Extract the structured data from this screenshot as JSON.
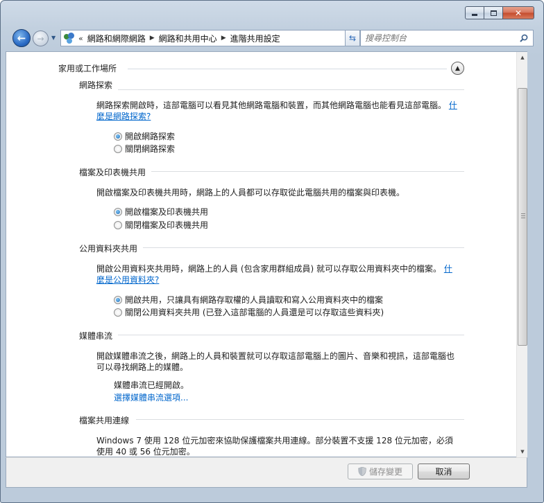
{
  "window": {
    "minimize_icon": "minimize-icon",
    "maximize_icon": "maximize-icon",
    "close_icon": "close-icon"
  },
  "nav": {
    "breadcrumb_overflow": "«",
    "breadcrumbs": [
      {
        "label": "網路和網際網路"
      },
      {
        "label": "網路和共用中心"
      },
      {
        "label": "進階共用設定"
      }
    ],
    "search_placeholder": "搜尋控制台"
  },
  "profile": {
    "title": "家用或工作場所"
  },
  "sections": [
    {
      "title": "網路探索",
      "description": "網路探索開啟時，這部電腦可以看見其他網路電腦和裝置，而其他網路電腦也能看見這部電腦。",
      "link": "什麼是網路探索?",
      "options": [
        {
          "label": "開啟網路探索",
          "checked": true
        },
        {
          "label": "關閉網路探索",
          "checked": false
        }
      ]
    },
    {
      "title": "檔案及印表機共用",
      "description": "開啟檔案及印表機共用時，網路上的人員都可以存取從此電腦共用的檔案與印表機。",
      "options": [
        {
          "label": "開啟檔案及印表機共用",
          "checked": true
        },
        {
          "label": "關閉檔案及印表機共用",
          "checked": false
        }
      ]
    },
    {
      "title": "公用資料夾共用",
      "description": "開啟公用資料夾共用時，網路上的人員 (包含家用群組成員) 就可以存取公用資料夾中的檔案。",
      "link": "什麼是公用資料夾?",
      "options": [
        {
          "label": "開啟共用，只讓具有網路存取權的人員讀取和寫入公用資料夾中的檔案",
          "checked": true
        },
        {
          "label": "關閉公用資料夾共用 (已登入這部電腦的人員還是可以存取這些資料夾)",
          "checked": false
        }
      ]
    },
    {
      "title": "媒體串流",
      "description": "開啟媒體串流之後，網路上的人員和裝置就可以存取這部電腦上的圖片、音樂和視訊，這部電腦也可以尋找網路上的媒體。",
      "status": "媒體串流已經開啟。",
      "link": "選擇媒體串流選項..."
    },
    {
      "title": "檔案共用連線",
      "description": "Windows 7 使用 128 位元加密來協助保護檔案共用連線。部分裝置不支援 128 位元加密，必須使用 40 或 56 位元加密。"
    }
  ],
  "buttons": {
    "save": "儲存變更",
    "cancel": "取消"
  }
}
